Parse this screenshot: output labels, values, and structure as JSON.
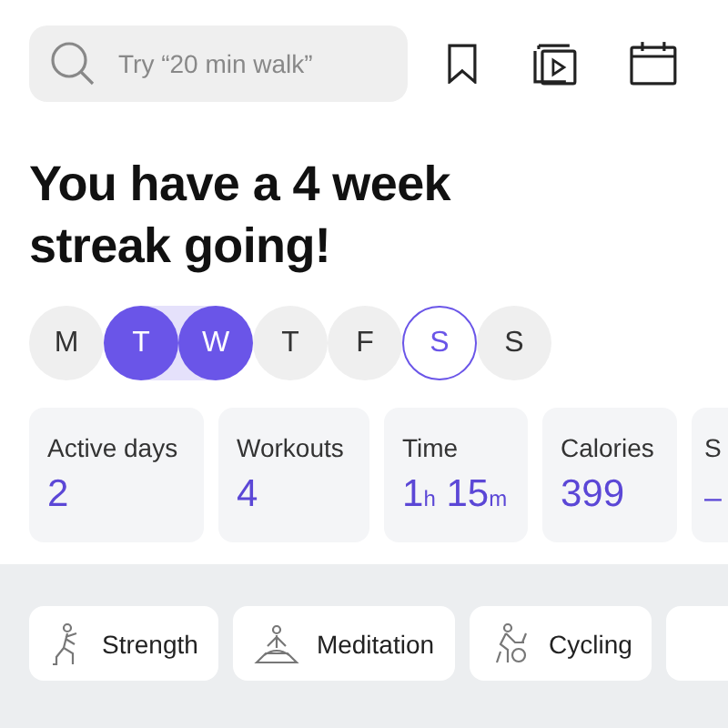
{
  "search": {
    "placeholder": "Try “20 min walk”"
  },
  "headline": "You have a 4 week streak going!",
  "days": [
    {
      "label": "M",
      "active": false,
      "today": false
    },
    {
      "label": "T",
      "active": true,
      "today": false
    },
    {
      "label": "W",
      "active": true,
      "today": false
    },
    {
      "label": "T",
      "active": false,
      "today": false
    },
    {
      "label": "F",
      "active": false,
      "today": false
    },
    {
      "label": "S",
      "active": false,
      "today": true
    },
    {
      "label": "S",
      "active": false,
      "today": false
    }
  ],
  "stats": [
    {
      "label": "Active days",
      "value": "2"
    },
    {
      "label": "Workouts",
      "value": "4"
    },
    {
      "label": "Time",
      "value": "1$_{h}$ 15$_{m}$"
    },
    {
      "label": "Calories",
      "value": "399"
    },
    {
      "label": "S",
      "value": "–"
    }
  ],
  "categories": [
    {
      "label": "Strength"
    },
    {
      "label": "Meditation"
    },
    {
      "label": "Cycling"
    }
  ]
}
